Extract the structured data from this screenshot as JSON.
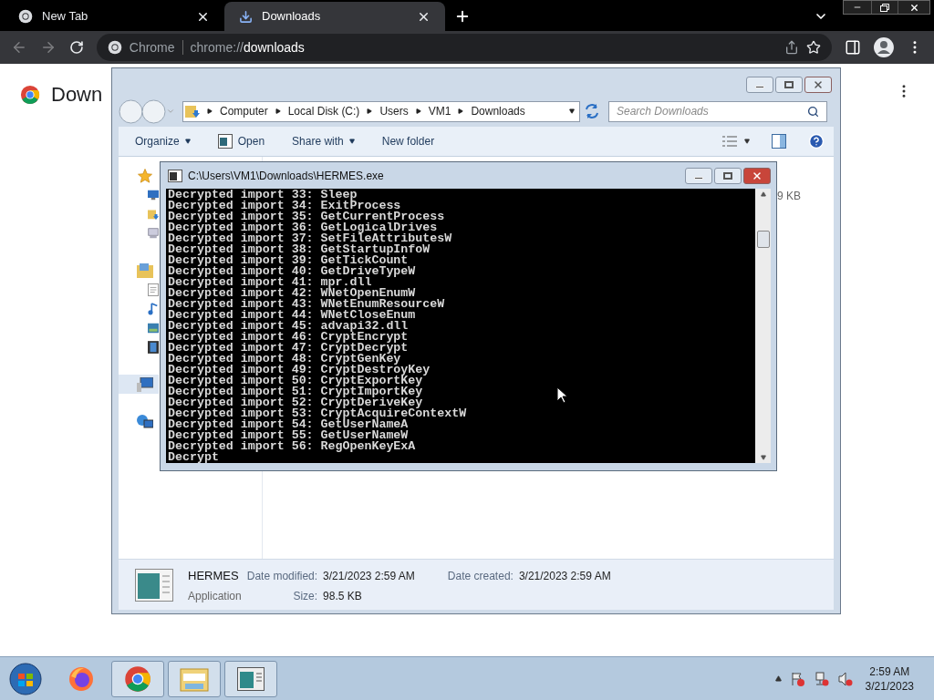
{
  "browser": {
    "tabs": [
      {
        "title": "New Tab",
        "kind": "chrome",
        "selected": false
      },
      {
        "title": "Downloads",
        "kind": "download",
        "selected": true
      }
    ],
    "address": {
      "site_label": "Chrome",
      "url_prefix": "chrome://",
      "url_path": "downloads"
    },
    "page": {
      "heading": "Down"
    }
  },
  "explorer": {
    "breadcrumbs": [
      "Computer",
      "Local Disk (C:)",
      "Users",
      "VM1",
      "Downloads"
    ],
    "search": {
      "placeholder": "Search Downloads"
    },
    "toolbar": [
      {
        "label": "Organize",
        "kind": "menu"
      },
      {
        "label": "Open",
        "kind": "open"
      },
      {
        "label": "Share with",
        "kind": "menu"
      },
      {
        "label": "New folder",
        "kind": "plain"
      }
    ],
    "nav": [
      {
        "kind": "star",
        "selected": false
      },
      {
        "kind": "desktop",
        "selected": false
      },
      {
        "kind": "downloads",
        "selected": false
      },
      {
        "kind": "places",
        "selected": false
      },
      {
        "kind": "library",
        "selected": false
      },
      {
        "kind": "document",
        "selected": false
      },
      {
        "kind": "music",
        "selected": false
      },
      {
        "kind": "pictures",
        "selected": false
      },
      {
        "kind": "video",
        "selected": false
      },
      {
        "kind": "computer",
        "selected": true
      },
      {
        "kind": "network",
        "selected": false
      }
    ],
    "file_size_fragment": "9 KB",
    "details": {
      "name": "HERMES",
      "type": "Application",
      "modified_label": "Date modified:",
      "modified": "3/21/2023 2:59 AM",
      "created_label": "Date created:",
      "created": "3/21/2023 2:59 AM",
      "size_label": "Size:",
      "size": "98.5 KB"
    }
  },
  "console": {
    "title": "C:\\Users\\VM1\\Downloads\\HERMES.exe",
    "lines": [
      "Decrypted import 33: Sleep",
      "Decrypted import 34: ExitProcess",
      "Decrypted import 35: GetCurrentProcess",
      "Decrypted import 36: GetLogicalDrives",
      "Decrypted import 37: SetFileAttributesW",
      "Decrypted import 38: GetStartupInfoW",
      "Decrypted import 39: GetTickCount",
      "Decrypted import 40: GetDriveTypeW",
      "Decrypted import 41: mpr.dll",
      "Decrypted import 42: WNetOpenEnumW",
      "Decrypted import 43: WNetEnumResourceW",
      "Decrypted import 44: WNetCloseEnum",
      "Decrypted import 45: advapi32.dll",
      "Decrypted import 46: CryptEncrypt",
      "Decrypted import 47: CryptDecrypt",
      "Decrypted import 48: CryptGenKey",
      "Decrypted import 49: CryptDestroyKey",
      "Decrypted import 50: CryptExportKey",
      "Decrypted import 51: CryptImportKey",
      "Decrypted import 52: CryptDeriveKey",
      "Decrypted import 53: CryptAcquireContextW",
      "Decrypted import 54: GetUserNameA",
      "Decrypted import 55: GetUserNameW",
      "Decrypted import 56: RegOpenKeyExA",
      "Decrypt"
    ]
  },
  "taskbar": {
    "apps": [
      {
        "kind": "firefox",
        "running": false
      },
      {
        "kind": "chrome",
        "running": true
      },
      {
        "kind": "explorer",
        "running": true
      },
      {
        "kind": "console",
        "running": true
      }
    ],
    "clock": {
      "time": "2:59 AM",
      "date": "3/21/2023"
    }
  }
}
